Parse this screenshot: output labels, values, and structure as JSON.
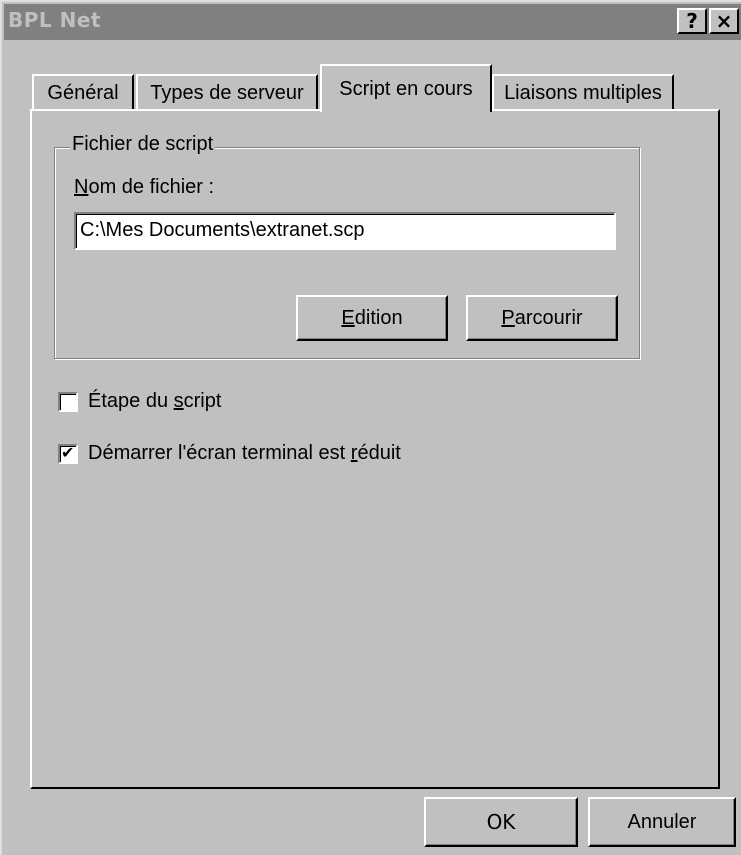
{
  "window": {
    "title": "BPL Net",
    "help_label": "?",
    "close_label": "×"
  },
  "tabs": [
    {
      "label": "Général",
      "selected": false
    },
    {
      "label": "Types de serveur",
      "selected": false
    },
    {
      "label": "Script en cours",
      "selected": true
    },
    {
      "label": "Liaisons multiples",
      "selected": false
    }
  ],
  "script_group": {
    "legend": "Fichier de script",
    "filename_label_mnemonic": "N",
    "filename_label_rest": "om de fichier :",
    "filename_value": "C:\\Mes Documents\\extranet.scp",
    "edit_button_mnemonic": "E",
    "edit_button_rest": "dition",
    "browse_button_mnemonic": "P",
    "browse_button_rest": "arcourir"
  },
  "options": {
    "step_label_pre": "Étape du ",
    "step_label_mnemonic": "s",
    "step_label_post": "cript",
    "step_checked": false,
    "terminal_label_pre": "Démarrer l'écran terminal est ",
    "terminal_label_mnemonic": "r",
    "terminal_label_post": "éduit",
    "terminal_checked": true,
    "check_glyph": "✔"
  },
  "footer": {
    "ok_label": "OK",
    "cancel_label": "Annuler"
  }
}
